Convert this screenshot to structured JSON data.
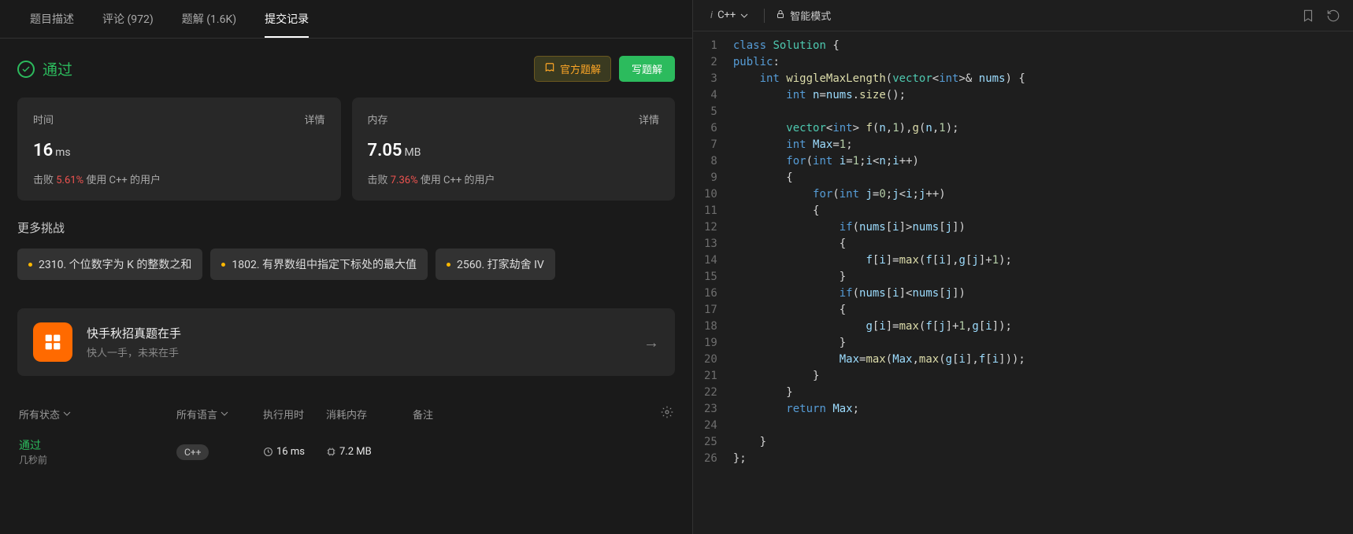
{
  "tabs": {
    "desc": "题目描述",
    "comments": "评论 (972)",
    "solutions": "题解 (1.6K)",
    "submissions": "提交记录"
  },
  "status": {
    "label": "通过"
  },
  "buttons": {
    "official": "官方题解",
    "write": "写题解"
  },
  "metrics": {
    "time": {
      "label": "时间",
      "detail": "详情",
      "value": "16",
      "unit": "ms",
      "beat_prefix": "击败 ",
      "pct": "5.61%",
      "beat_suffix": " 使用 C++ 的用户"
    },
    "mem": {
      "label": "内存",
      "detail": "详情",
      "value": "7.05",
      "unit": "MB",
      "beat_prefix": "击败 ",
      "pct": "7.36%",
      "beat_suffix": " 使用 C++ 的用户"
    }
  },
  "more_title": "更多挑战",
  "challenges": [
    {
      "num": "2310.",
      "title": "个位数字为 K 的整数之和"
    },
    {
      "num": "1802.",
      "title": "有界数组中指定下标处的最大值"
    },
    {
      "num": "2560.",
      "title": "打家劫舍 IV"
    }
  ],
  "promo": {
    "title": "快手秋招真题在手",
    "sub": "快人一手，未来在手"
  },
  "table": {
    "status": "所有状态",
    "lang": "所有语言",
    "time": "执行用时",
    "mem": "消耗内存",
    "note": "备注"
  },
  "submission": {
    "status": "通过",
    "ago": "几秒前",
    "lang": "C++",
    "time": "16 ms",
    "mem": "7.2 MB"
  },
  "editor": {
    "lang": "C++",
    "mode": "智能模式",
    "lang_prefix": "i"
  },
  "code_lines": [
    {
      "n": 1,
      "t": [
        [
          "k-kw",
          "class"
        ],
        [
          "",
          " "
        ],
        [
          "k-type",
          "Solution"
        ],
        [
          "",
          " {"
        ]
      ]
    },
    {
      "n": 2,
      "t": [
        [
          "k-kw",
          "public"
        ],
        [
          "",
          ":"
        ]
      ]
    },
    {
      "n": 3,
      "t": [
        [
          "",
          "    "
        ],
        [
          "k-kw",
          "int"
        ],
        [
          "",
          " "
        ],
        [
          "k-fn",
          "wiggleMaxLength"
        ],
        [
          "",
          "("
        ],
        [
          "k-type",
          "vector"
        ],
        [
          "",
          "<"
        ],
        [
          "k-kw",
          "int"
        ],
        [
          "",
          ">& "
        ],
        [
          "k-var",
          "nums"
        ],
        [
          "",
          ") {"
        ]
      ]
    },
    {
      "n": 4,
      "t": [
        [
          "",
          "        "
        ],
        [
          "k-kw",
          "int"
        ],
        [
          "",
          " "
        ],
        [
          "k-var",
          "n"
        ],
        [
          "",
          "="
        ],
        [
          "k-var",
          "nums"
        ],
        [
          "",
          "."
        ],
        [
          "k-fn",
          "size"
        ],
        [
          "",
          "();"
        ]
      ]
    },
    {
      "n": 5,
      "t": [
        [
          "",
          ""
        ]
      ]
    },
    {
      "n": 6,
      "t": [
        [
          "",
          "        "
        ],
        [
          "k-type",
          "vector"
        ],
        [
          "",
          "<"
        ],
        [
          "k-kw",
          "int"
        ],
        [
          "",
          "> "
        ],
        [
          "k-fn",
          "f"
        ],
        [
          "",
          "("
        ],
        [
          "k-var",
          "n"
        ],
        [
          "",
          ","
        ],
        [
          "k-num",
          "1"
        ],
        [
          "",
          "),"
        ],
        [
          "k-fn",
          "g"
        ],
        [
          "",
          "("
        ],
        [
          "k-var",
          "n"
        ],
        [
          "",
          ","
        ],
        [
          "k-num",
          "1"
        ],
        [
          "",
          ");"
        ]
      ]
    },
    {
      "n": 7,
      "t": [
        [
          "",
          "        "
        ],
        [
          "k-kw",
          "int"
        ],
        [
          "",
          " "
        ],
        [
          "k-var",
          "Max"
        ],
        [
          "",
          "="
        ],
        [
          "k-num",
          "1"
        ],
        [
          "",
          ";"
        ]
      ]
    },
    {
      "n": 8,
      "t": [
        [
          "",
          "        "
        ],
        [
          "k-kw",
          "for"
        ],
        [
          "",
          "("
        ],
        [
          "k-kw",
          "int"
        ],
        [
          "",
          " "
        ],
        [
          "k-var",
          "i"
        ],
        [
          "",
          "="
        ],
        [
          "k-num",
          "1"
        ],
        [
          "",
          ";"
        ],
        [
          "k-var",
          "i"
        ],
        [
          "",
          "<"
        ],
        [
          "k-var",
          "n"
        ],
        [
          "",
          ";"
        ],
        [
          "k-var",
          "i"
        ],
        [
          "",
          "++)"
        ]
      ]
    },
    {
      "n": 9,
      "t": [
        [
          "",
          "        {"
        ]
      ]
    },
    {
      "n": 10,
      "t": [
        [
          "",
          "            "
        ],
        [
          "k-kw",
          "for"
        ],
        [
          "",
          "("
        ],
        [
          "k-kw",
          "int"
        ],
        [
          "",
          " "
        ],
        [
          "k-var",
          "j"
        ],
        [
          "",
          "="
        ],
        [
          "k-num",
          "0"
        ],
        [
          "",
          ";"
        ],
        [
          "k-var",
          "j"
        ],
        [
          "",
          "<"
        ],
        [
          "k-var",
          "i"
        ],
        [
          "",
          ";"
        ],
        [
          "k-var",
          "j"
        ],
        [
          "",
          "++)"
        ]
      ]
    },
    {
      "n": 11,
      "t": [
        [
          "",
          "            {"
        ]
      ]
    },
    {
      "n": 12,
      "t": [
        [
          "",
          "                "
        ],
        [
          "k-kw",
          "if"
        ],
        [
          "",
          "("
        ],
        [
          "k-var",
          "nums"
        ],
        [
          "",
          "["
        ],
        [
          "k-var",
          "i"
        ],
        [
          "",
          "]>"
        ],
        [
          "k-var",
          "nums"
        ],
        [
          "",
          "["
        ],
        [
          "k-var",
          "j"
        ],
        [
          "",
          "])"
        ]
      ]
    },
    {
      "n": 13,
      "t": [
        [
          "",
          "                {"
        ]
      ]
    },
    {
      "n": 14,
      "t": [
        [
          "",
          "                    "
        ],
        [
          "k-var",
          "f"
        ],
        [
          "",
          "["
        ],
        [
          "k-var",
          "i"
        ],
        [
          "",
          "]="
        ],
        [
          "k-fn",
          "max"
        ],
        [
          "",
          "("
        ],
        [
          "k-var",
          "f"
        ],
        [
          "",
          "["
        ],
        [
          "k-var",
          "i"
        ],
        [
          "",
          "],"
        ],
        [
          "k-var",
          "g"
        ],
        [
          "",
          "["
        ],
        [
          "k-var",
          "j"
        ],
        [
          "",
          "]+"
        ],
        [
          "k-num",
          "1"
        ],
        [
          "",
          ");"
        ]
      ]
    },
    {
      "n": 15,
      "t": [
        [
          "",
          "                }"
        ]
      ]
    },
    {
      "n": 16,
      "t": [
        [
          "",
          "                "
        ],
        [
          "k-kw",
          "if"
        ],
        [
          "",
          "("
        ],
        [
          "k-var",
          "nums"
        ],
        [
          "",
          "["
        ],
        [
          "k-var",
          "i"
        ],
        [
          "",
          "]<"
        ],
        [
          "k-var",
          "nums"
        ],
        [
          "",
          "["
        ],
        [
          "k-var",
          "j"
        ],
        [
          "",
          "])"
        ]
      ]
    },
    {
      "n": 17,
      "t": [
        [
          "",
          "                {"
        ]
      ]
    },
    {
      "n": 18,
      "t": [
        [
          "",
          "                    "
        ],
        [
          "k-var",
          "g"
        ],
        [
          "",
          "["
        ],
        [
          "k-var",
          "i"
        ],
        [
          "",
          "]="
        ],
        [
          "k-fn",
          "max"
        ],
        [
          "",
          "("
        ],
        [
          "k-var",
          "f"
        ],
        [
          "",
          "["
        ],
        [
          "k-var",
          "j"
        ],
        [
          "",
          "]+"
        ],
        [
          "k-num",
          "1"
        ],
        [
          "",
          ","
        ],
        [
          "k-var",
          "g"
        ],
        [
          "",
          "["
        ],
        [
          "k-var",
          "i"
        ],
        [
          "",
          "]);"
        ]
      ]
    },
    {
      "n": 19,
      "t": [
        [
          "",
          "                }"
        ]
      ]
    },
    {
      "n": 20,
      "t": [
        [
          "",
          "                "
        ],
        [
          "k-var",
          "Max"
        ],
        [
          "",
          "="
        ],
        [
          "k-fn",
          "max"
        ],
        [
          "",
          "("
        ],
        [
          "k-var",
          "Max"
        ],
        [
          "",
          ","
        ],
        [
          "k-fn",
          "max"
        ],
        [
          "",
          "("
        ],
        [
          "k-var",
          "g"
        ],
        [
          "",
          "["
        ],
        [
          "k-var",
          "i"
        ],
        [
          "",
          "],"
        ],
        [
          "k-var",
          "f"
        ],
        [
          "",
          "["
        ],
        [
          "k-var",
          "i"
        ],
        [
          "",
          "]));"
        ]
      ]
    },
    {
      "n": 21,
      "t": [
        [
          "",
          "            }"
        ]
      ]
    },
    {
      "n": 22,
      "t": [
        [
          "",
          "        }"
        ]
      ]
    },
    {
      "n": 23,
      "t": [
        [
          "",
          "        "
        ],
        [
          "k-kw",
          "return"
        ],
        [
          "",
          " "
        ],
        [
          "k-var",
          "Max"
        ],
        [
          "",
          ";"
        ]
      ]
    },
    {
      "n": 24,
      "t": [
        [
          "",
          ""
        ]
      ]
    },
    {
      "n": 25,
      "t": [
        [
          "",
          "    }"
        ]
      ]
    },
    {
      "n": 26,
      "t": [
        [
          "",
          "};"
        ]
      ]
    }
  ]
}
